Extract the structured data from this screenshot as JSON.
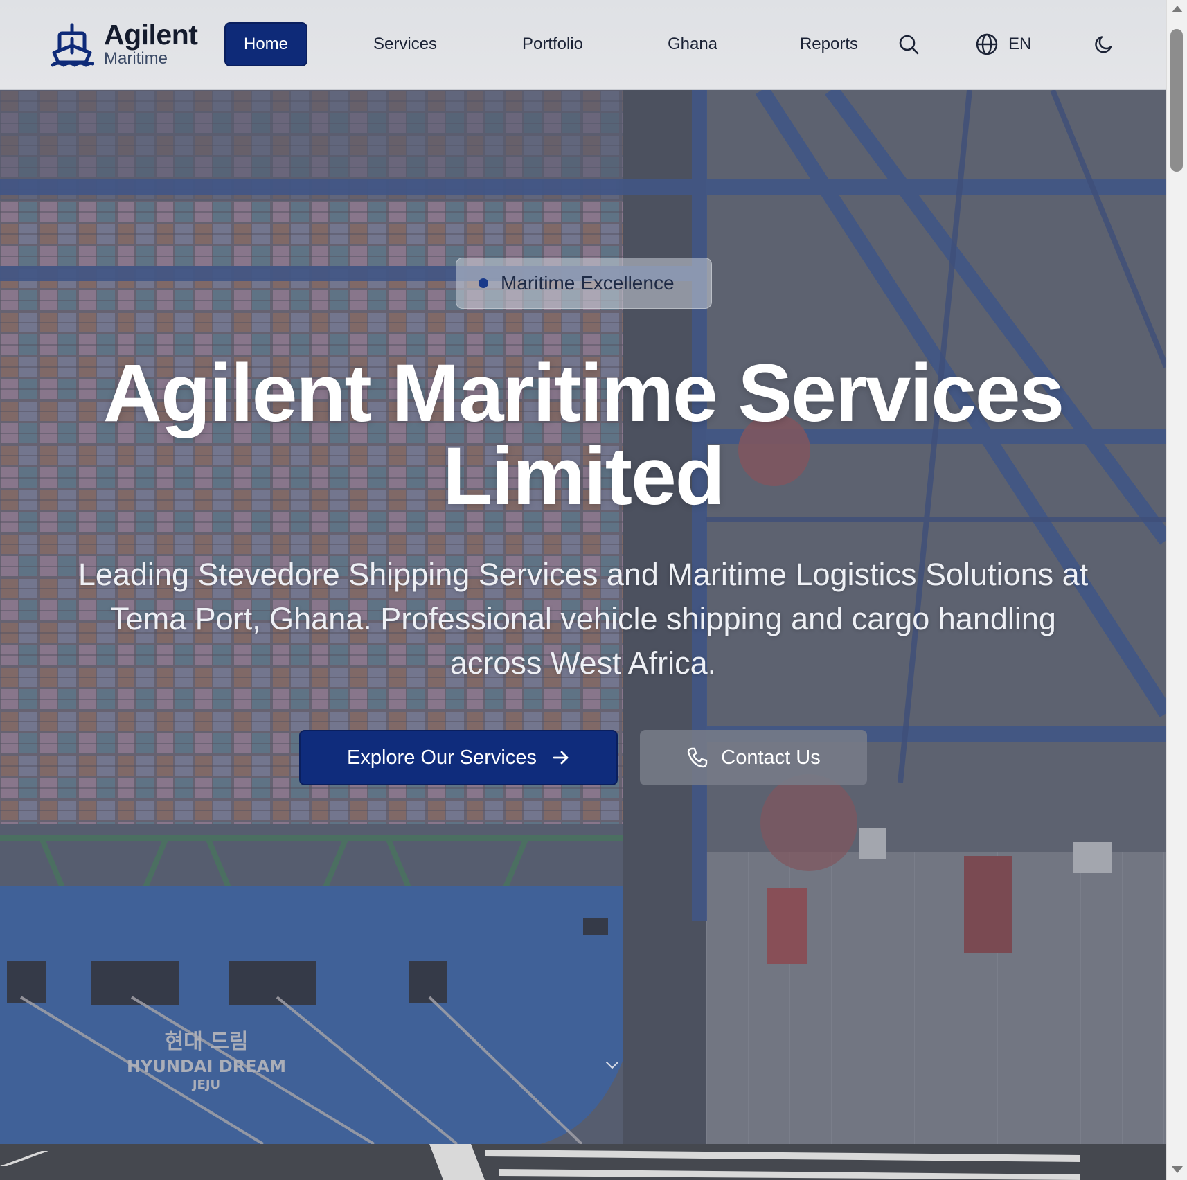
{
  "header": {
    "logo": {
      "title": "Agilent",
      "subtitle": "Maritime",
      "icon": "ship-icon"
    },
    "nav": [
      {
        "label": "Home",
        "active": true
      },
      {
        "label": "Services"
      },
      {
        "label": "Portfolio"
      },
      {
        "label": "Ghana"
      },
      {
        "label": "Reports"
      }
    ],
    "search_icon": "search-icon",
    "language": {
      "icon": "globe-icon",
      "label": "EN"
    },
    "theme_icon": "moon-icon"
  },
  "hero": {
    "badge": "Maritime Excellence",
    "title_line1": "Agilent Maritime Services",
    "title_line2": "Limited",
    "subtitle_line1": "Leading Stevedore Shipping Services and Maritime Logistics Solutions at",
    "subtitle_line2": "Tema Port, Ghana. Professional vehicle shipping and cargo handling",
    "subtitle_line3": "across West Africa.",
    "primary_cta": "Explore Our Services",
    "secondary_cta": "Contact Us",
    "ship_name_korean": "현대 드림",
    "ship_name": "HYUNDAI DREAM",
    "ship_port": "JEJU"
  },
  "colors": {
    "brand_navy": "#0f2c7c",
    "header_bg": "#e2e3e7",
    "text_dark": "#141b2d"
  }
}
